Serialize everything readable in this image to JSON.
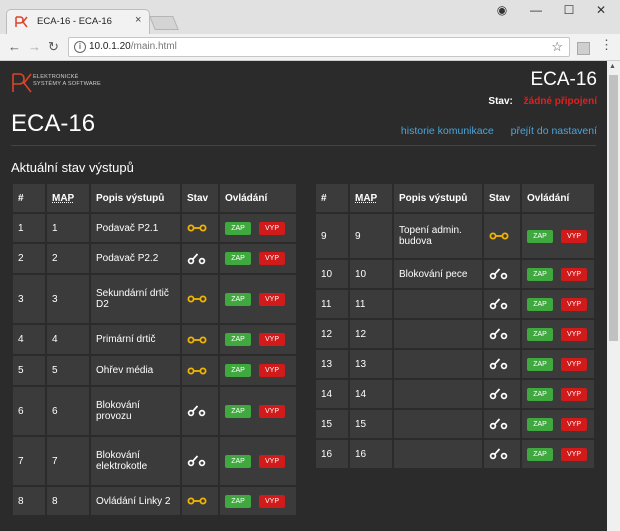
{
  "browser": {
    "tab_title": "ECA-16 - ECA-16",
    "tab_close": "×",
    "url_host": "10.0.1.20",
    "url_path": "/main.html",
    "nav": {
      "back": "←",
      "forward": "→",
      "reload": "↻"
    },
    "window": {
      "account": "◉",
      "minimize": "—",
      "maximize": "☐",
      "close": "✕"
    }
  },
  "page": {
    "logo_text_line1": "ELEKTRONICKÉ",
    "logo_text_line2": "SYSTÉMY A SOFTWARE",
    "device_title": "ECA-16",
    "status_label": "Stav:",
    "status_value": "žádné připojení",
    "title": "ECA-16",
    "link_history": "historie komunikace",
    "link_settings": "přejít do nastavení",
    "section_title": "Aktuální stav výstupů",
    "columns": [
      "#",
      "MAP",
      "Popis výstupů",
      "Stav",
      "Ovládání"
    ],
    "btn_on": "ZAP",
    "btn_off": "VYP",
    "colors": {
      "accent": "#4aa5d9",
      "on": "#3fa93f",
      "off": "#d11a1a",
      "closed_state": "#f2b400",
      "alert": "#e02020"
    }
  },
  "outputs_left": [
    {
      "num": "1",
      "map": "1",
      "desc": "Podavač P2.1",
      "state": "closed"
    },
    {
      "num": "2",
      "map": "2",
      "desc": "Podavač P2.2",
      "state": "open"
    },
    {
      "num": "3",
      "map": "3",
      "desc": "Sekundární drtič D2",
      "state": "closed"
    },
    {
      "num": "4",
      "map": "4",
      "desc": "Primární drtič",
      "state": "closed"
    },
    {
      "num": "5",
      "map": "5",
      "desc": "Ohřev média",
      "state": "closed"
    },
    {
      "num": "6",
      "map": "6",
      "desc": "Blokování provozu",
      "state": "open"
    },
    {
      "num": "7",
      "map": "7",
      "desc": "Blokování elektrokotle",
      "state": "open"
    },
    {
      "num": "8",
      "map": "8",
      "desc": "Ovládání Linky 2",
      "state": "closed"
    }
  ],
  "outputs_right": [
    {
      "num": "9",
      "map": "9",
      "desc": "Topení admin. budova",
      "state": "closed"
    },
    {
      "num": "10",
      "map": "10",
      "desc": "Blokování pece",
      "state": "open"
    },
    {
      "num": "11",
      "map": "11",
      "desc": "",
      "state": "open"
    },
    {
      "num": "12",
      "map": "12",
      "desc": "",
      "state": "open"
    },
    {
      "num": "13",
      "map": "13",
      "desc": "",
      "state": "open"
    },
    {
      "num": "14",
      "map": "14",
      "desc": "",
      "state": "open"
    },
    {
      "num": "15",
      "map": "15",
      "desc": "",
      "state": "open"
    },
    {
      "num": "16",
      "map": "16",
      "desc": "",
      "state": "open"
    }
  ]
}
